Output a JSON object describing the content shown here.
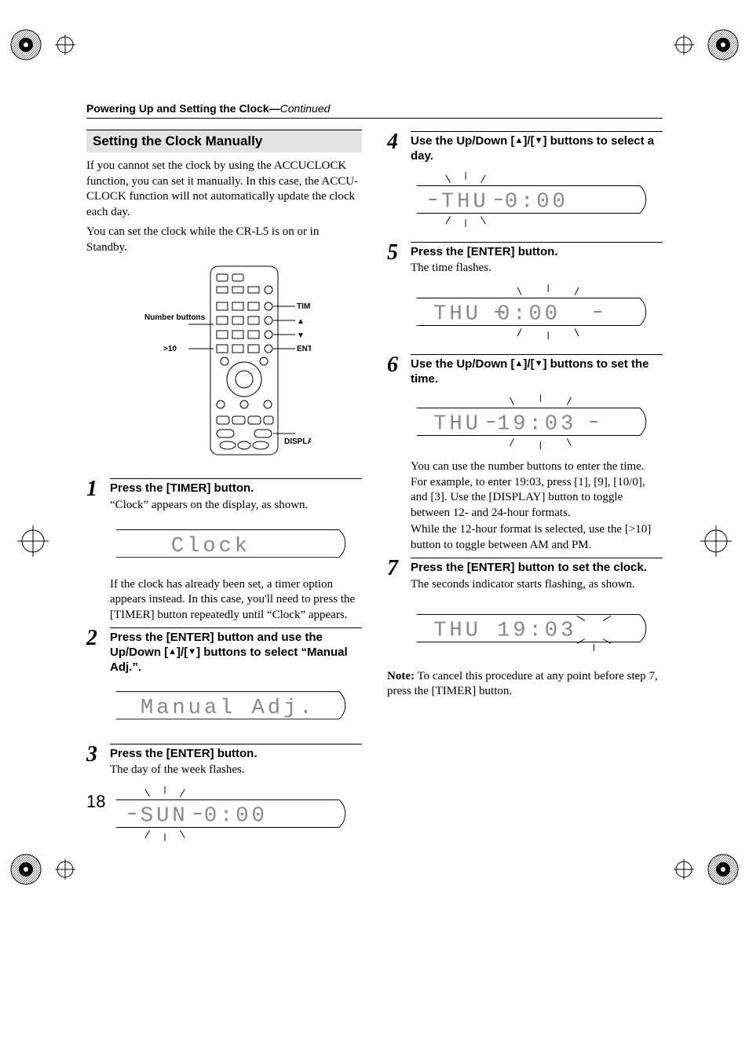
{
  "header": {
    "section": "Powering Up and Setting the Clock—",
    "continued": "Continued"
  },
  "subsection": "Setting the Clock Manually",
  "intro1": "If you cannot set the clock by using the ACCUCLOCK function, you can set it manually. In this case, the ACCU-CLOCK function will not automatically update the clock each day.",
  "intro2": "You can set the clock while the CR-L5 is on or in Standby.",
  "remote_labels": {
    "number_buttons": "Number buttons",
    "gt10": ">10",
    "timer": "TIMER",
    "up": "▲",
    "down": "▼",
    "enter": "ENTER",
    "display": "DISPLAY"
  },
  "steps": {
    "s1": {
      "head": "Press the [TIMER] button.",
      "desc": "“Clock” appears on the display, as shown.",
      "lcd": "Clock",
      "after": "If the clock has already been set, a timer option appears instead. In this case, you'll need to press the [TIMER] button repeatedly until “Clock” appears."
    },
    "s2": {
      "head1": "Press the [ENTER] button and use the Up/Down [",
      "head2": "]/[",
      "head3": "] buttons to select “Manual Adj.”.",
      "lcd": "Manual Adj."
    },
    "s3": {
      "head": "Press the [ENTER] button.",
      "desc": "The day of the week flashes.",
      "lcd": "SUN   0:00",
      "lcd_flash": "SUN"
    },
    "s4": {
      "head1": "Use the Up/Down [",
      "head2": "]/[",
      "head3": "] buttons to select a day.",
      "lcd": "THU   0:00",
      "lcd_flash": "THU"
    },
    "s5": {
      "head": "Press the [ENTER] button.",
      "desc": "The time flashes.",
      "lcd": "THU   0:00",
      "lcd_flash": "0:00"
    },
    "s6": {
      "head1": "Use the Up/Down [",
      "head2": "]/[",
      "head3": "] buttons to set the time.",
      "lcd": "THU 19:03",
      "lcd_flash": "19:03",
      "desc1": "You can use the number buttons to enter the time. For example, to enter 19:03, press [1], [9], [10/0], and [3]. Use the [DISPLAY] button to toggle between 12- and 24-hour formats.",
      "desc2": "While the 12-hour format is selected, use the [>10] button to toggle between AM and PM."
    },
    "s7": {
      "head": "Press the [ENTER] button to set the clock.",
      "desc": "The seconds indicator starts flashing, as shown.",
      "lcd": "THU 19:03"
    }
  },
  "note_label": "Note:",
  "note": " To cancel this procedure at any point before step 7, press the [TIMER] button.",
  "page_number": "18"
}
